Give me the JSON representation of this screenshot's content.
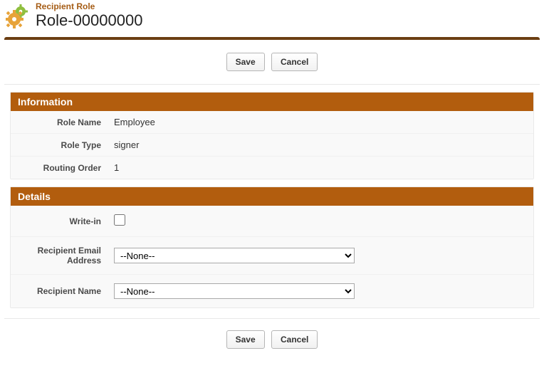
{
  "header": {
    "subtitle": "Recipient Role",
    "title": "Role-00000000"
  },
  "buttons": {
    "save": "Save",
    "cancel": "Cancel"
  },
  "sections": {
    "information": {
      "heading": "Information",
      "role_name_label": "Role Name",
      "role_name_value": "Employee",
      "role_type_label": "Role Type",
      "role_type_value": "signer",
      "routing_order_label": "Routing Order",
      "routing_order_value": "1"
    },
    "details": {
      "heading": "Details",
      "write_in_label": "Write-in",
      "write_in_checked": false,
      "recipient_email_label": "Recipient Email Address",
      "recipient_email_value": "--None--",
      "recipient_name_label": "Recipient Name",
      "recipient_name_value": "--None--"
    }
  }
}
